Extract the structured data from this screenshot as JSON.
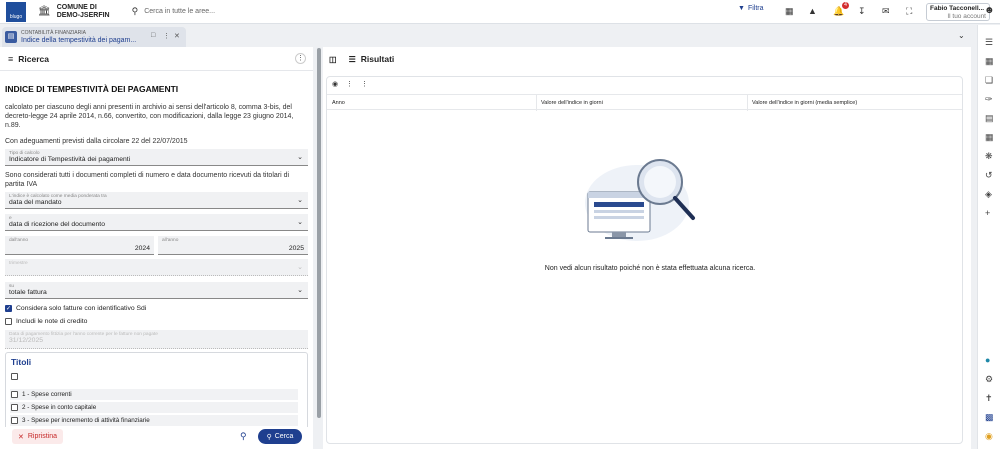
{
  "topbar": {
    "org_line1": "COMUNE DI",
    "org_line2": "DEMO-JSERFIN",
    "search_placeholder": "Cerca in tutte le aree...",
    "filter_label": "Filtra",
    "notification_count": "4",
    "user_name": "Fabio Tacconell...",
    "user_profile": "Il tuo account"
  },
  "tab": {
    "module": "CONTABILITÀ FINANZIARIA",
    "title": "Indice della tempestività dei pagam..."
  },
  "left_panel": {
    "title": "Ricerca",
    "heading": "INDICE DI TEMPESTIVITÀ DEI PAGAMENTI",
    "description": "calcolato per ciascuno degli anni presenti in archivio ai sensi dell'articolo 8, comma 3-bis, del decreto-legge 24 aprile 2014, n.66, convertito, con modificazioni, dalla legge 23 giugno 2014, n.89.",
    "note": "Con adeguamenti previsti dalla circolare 22 del 22/07/2015",
    "tipo_calcolo": {
      "label": "Tipo di calcolo",
      "value": "Indicatore di Tempestività dei pagamenti"
    },
    "documents_note": "Sono considerati tutti i documenti completi di numero e data documento ricevuti da titolari di partita IVA",
    "media_ponderata": {
      "label": "L'indice è calcolato come media ponderata tra",
      "value": "data del mandato"
    },
    "e_field": {
      "label": "e",
      "value": "data di ricezione del documento"
    },
    "dall_anno": {
      "label": "dall'anno",
      "value": "2024"
    },
    "all_anno": {
      "label": "all'anno",
      "value": "2025"
    },
    "trimestre": {
      "label": "trimestre",
      "value": ""
    },
    "su_field": {
      "label": "su",
      "value": "totale fattura"
    },
    "check_sdi": "Considera solo fatture con identificativo Sdi",
    "check_note": "Includi le note di credito",
    "data_pagamento": {
      "label": "Data di pagamento fittizia per l'anno corrente per le fatture non pagate",
      "value": "31/12/2025"
    },
    "titoli_title": "Titoli",
    "titoli": [
      "1 - Spese correnti",
      "2 - Spese in conto capitale",
      "3 - Spese per incremento di attività finanziarie"
    ],
    "reset_label": "Ripristina",
    "search_label": "Cerca"
  },
  "right_panel": {
    "title": "Risultati",
    "columns": [
      "Anno",
      "Valore dell'indice in giorni",
      "Valore dell'indice in giorni (media semplice)"
    ],
    "empty_message": "Non vedi alcun risultato poiché non è stata effettuata alcuna ricerca."
  }
}
